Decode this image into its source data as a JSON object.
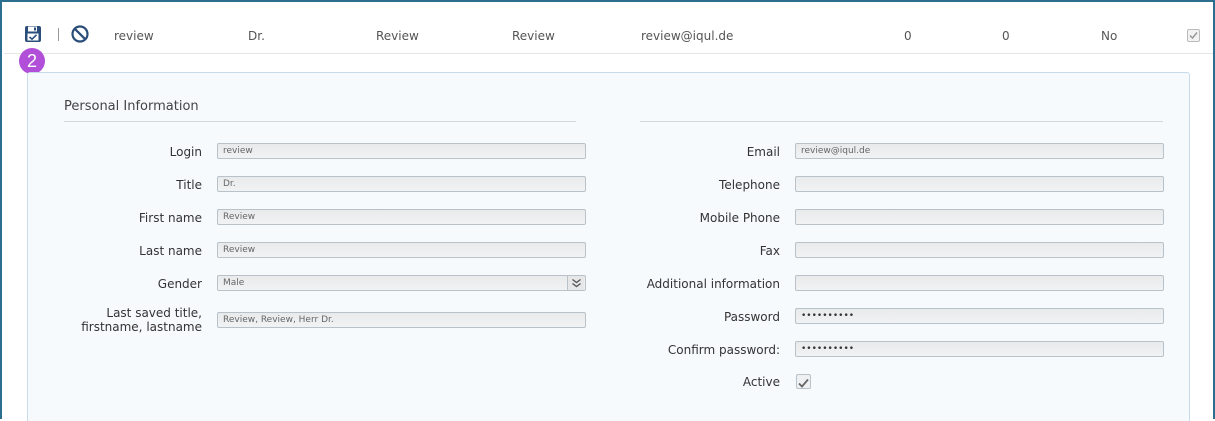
{
  "row": {
    "login": "review",
    "title": "Dr.",
    "first_name": "Review",
    "last_name": "Review",
    "email": "review@iqul.de",
    "count_a": "0",
    "count_b": "0",
    "flag": "No",
    "checked": true,
    "badge": "2"
  },
  "panel": {
    "section_title": "Personal Information",
    "left": {
      "login_label": "Login",
      "login_value": "review",
      "title_label": "Title",
      "title_value": "Dr.",
      "first_name_label": "First name",
      "first_name_value": "Review",
      "last_name_label": "Last name",
      "last_name_value": "Review",
      "gender_label": "Gender",
      "gender_value": "Male",
      "last_saved_label_1": "Last saved title,",
      "last_saved_label_2": "firstname, lastname",
      "last_saved_value": "Review, Review, Herr Dr."
    },
    "right": {
      "email_label": "Email",
      "email_value": "review@iqul.de",
      "telephone_label": "Telephone",
      "telephone_value": "",
      "mobile_label": "Mobile Phone",
      "mobile_value": "",
      "fax_label": "Fax",
      "fax_value": "",
      "additional_label": "Additional information",
      "additional_value": "",
      "password_label": "Password",
      "password_value": "••••••••••",
      "confirm_label": "Confirm password:",
      "confirm_value": "••••••••••",
      "active_label": "Active",
      "active_checked": true
    }
  },
  "colors": {
    "frame_border": "#2b6e8f",
    "badge": "#b14fd8",
    "icon": "#2a4d7a"
  },
  "icons": {
    "save": "save-check-icon",
    "cancel": "cancel-circle-icon",
    "select": "double-chevron-down-icon",
    "checkbox": "checkmark-icon"
  }
}
